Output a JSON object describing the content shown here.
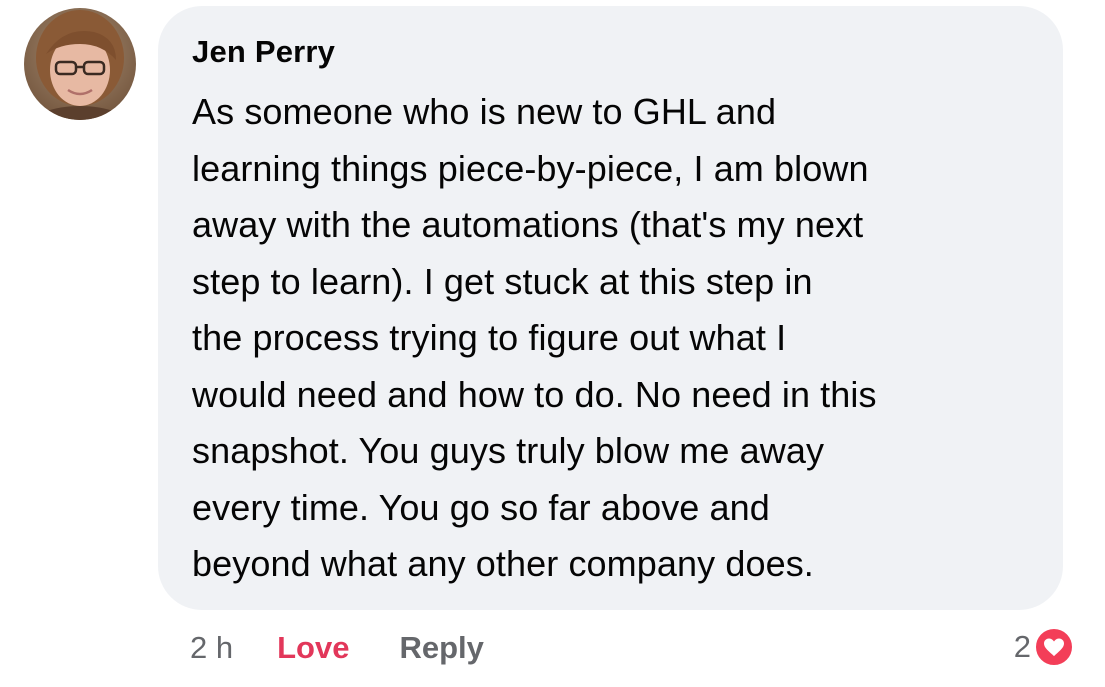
{
  "comment": {
    "author": "Jen Perry",
    "text_lines": [
      "As someone who is new to GHL and",
      "learning things piece-by-piece, I am blown",
      "away with the automations (that's my next",
      "step to learn). I get stuck  at this step in",
      "the process trying to figure out what I",
      "would need and how to do. No need in this",
      "snapshot. You guys truly blow me away",
      "every time. You go so far above and",
      "beyond what any other company does."
    ],
    "timestamp": "2 h",
    "love_label": "Love",
    "reply_label": "Reply",
    "reaction_count": "2",
    "reaction_icon": "heart-icon"
  },
  "colors": {
    "bubble_bg": "#f0f2f5",
    "text": "#050505",
    "secondary_text": "#65676b",
    "love_red": "#e2375a",
    "love_reaction_bg": "#f33e58"
  }
}
